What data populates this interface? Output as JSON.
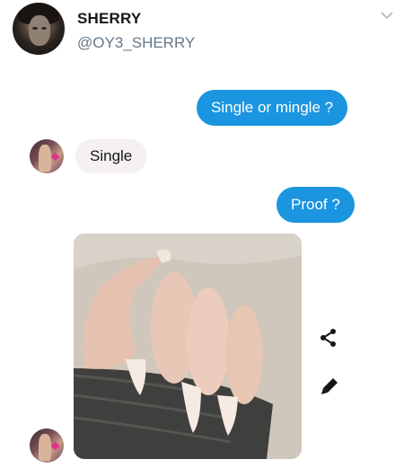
{
  "header": {
    "name": "SHERRY",
    "handle": "@OY3_SHERRY",
    "avatar_icon": "user-avatar-icon",
    "menu_icon": "chevron-down-icon"
  },
  "messages": [
    {
      "direction": "outgoing",
      "text": "Single or mingle ?"
    },
    {
      "direction": "incoming",
      "text": "Single"
    },
    {
      "direction": "outgoing",
      "text": "Proof ?"
    },
    {
      "direction": "incoming",
      "type": "image",
      "image_icon": "hand-photo"
    }
  ],
  "actions": {
    "share_icon": "share-icon",
    "edit_icon": "pencil-icon"
  },
  "colors": {
    "outgoing_bubble": "#1b95e0",
    "incoming_bubble": "#f5f0f1",
    "handle_text": "#657786"
  }
}
